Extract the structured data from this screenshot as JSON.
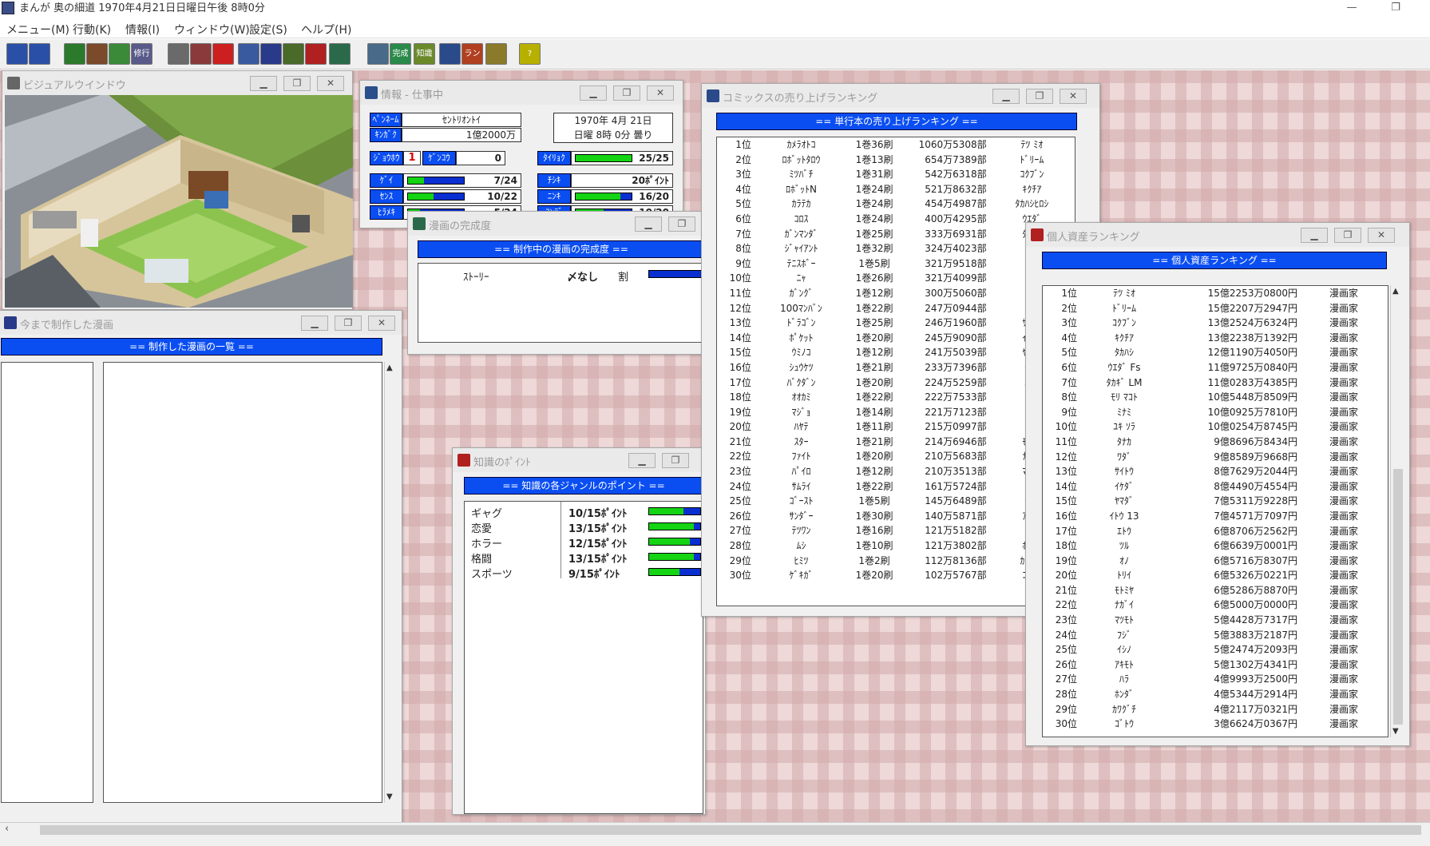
{
  "app": {
    "title": "まんが 奥の細道 1970年4月21日日曜日午後 8時0分",
    "min_icon": "—",
    "max_icon": "❐"
  },
  "menu": [
    "メニュー(M)",
    "行動(K)",
    "情報(I)",
    "ウィンドウ(W)",
    "設定(S)",
    "ヘルプ(H)"
  ],
  "toolbar": {
    "buttons": [
      {
        "name": "save-tool",
        "label": "",
        "color": "#2a4fa6"
      },
      {
        "name": "load-tool",
        "label": "",
        "color": "#2a4fa6"
      },
      {
        "name": "clock-tool",
        "label": "",
        "color": "#2b7a2b"
      },
      {
        "name": "work-tool",
        "label": "",
        "color": "#7a4a2a"
      },
      {
        "name": "people-tool",
        "label": "",
        "color": "#3a8a3a"
      },
      {
        "name": "travel-tool",
        "label": "修行",
        "color": "#5a5a8a"
      },
      {
        "name": "building-tool",
        "label": "",
        "color": "#6a6a6a"
      },
      {
        "name": "schedule-tool",
        "label": "",
        "color": "#8a3a3a"
      },
      {
        "name": "mailbox-tool",
        "label": "",
        "color": "#cc2020"
      },
      {
        "name": "person-tool",
        "label": "",
        "color": "#3a5aa0"
      },
      {
        "name": "assistant-tool",
        "label": "",
        "color": "#2a3a8a"
      },
      {
        "name": "staff-tool",
        "label": "",
        "color": "#4a6a2a"
      },
      {
        "name": "car-tool",
        "label": "",
        "color": "#b02020"
      },
      {
        "name": "book-tool",
        "label": "",
        "color": "#2a6a4a"
      },
      {
        "name": "info-tool",
        "label": "",
        "color": "#4a6a8a"
      },
      {
        "name": "completion-tool",
        "label": "完成",
        "color": "#2a8a4a"
      },
      {
        "name": "knowledge-tool",
        "label": "知識",
        "color": "#6a8a2a"
      },
      {
        "name": "comics-tool",
        "label": "",
        "color": "#2a4a8a"
      },
      {
        "name": "ranking-tool",
        "label": "ランキング",
        "color": "#b04020"
      },
      {
        "name": "trophy-tool",
        "label": "",
        "color": "#8a7a2a"
      },
      {
        "name": "help-tool",
        "label": "?",
        "color": "#b8b000"
      }
    ]
  },
  "windows": {
    "visual": {
      "title": "ビジュアルウインドウ"
    },
    "info": {
      "title": "情報 - 仕事中",
      "name_label": "ﾍﾟﾝﾈｰﾑ",
      "name_value": "ｾﾝﾄﾘｵﾝﾄｲ",
      "money_label": "ｷﾝｶﾞｸ",
      "money_value": "1億2000万",
      "date_line1": "1970年 4月 21日",
      "date_line2": "日曜 8時 0分 曇り",
      "s1_label": "ｼﾞｮｳﾎｳ",
      "s1_value": "1",
      "s2_label": "ｹﾞﾝｺｳ",
      "s2_value": "0",
      "s3_label": "ﾀｲﾘｮｸ",
      "s3_value": "25/25",
      "s3_ratio": 1.0,
      "stats": [
        {
          "label": "ｹﾞｲ",
          "value": "7/24",
          "ratio": 0.29
        },
        {
          "label": "ﾁｼｷ",
          "value": "20ﾎﾟｲﾝﾄ",
          "ratio": null
        },
        {
          "label": "ｾﾝｽ",
          "value": "10/22",
          "ratio": 0.45
        },
        {
          "label": "ﾆﾝｷ",
          "value": "16/20",
          "ratio": 0.8
        },
        {
          "label": "ﾋﾗﾒｷ",
          "value": "5/24",
          "ratio": 0.21
        },
        {
          "label": "ｺﾝﾃﾞ",
          "value": "10/20",
          "ratio": 0.5
        }
      ]
    },
    "completion": {
      "title": "漫画の完成度",
      "header": "== 制作中の漫画の完成度 ==",
      "item_label": "ｽﾄｰﾘｰ",
      "item_status": "〆なし",
      "item_unit": "割",
      "ratio": 1.0
    },
    "made": {
      "title": "今まで制作した漫画",
      "header": "== 制作した漫画の一覧 =="
    },
    "knowledge": {
      "title": "知識のﾎﾟｲﾝﾄ",
      "header": "== 知識の各ジャンルのポイント ==",
      "rows": [
        {
          "label": "ギャグ",
          "value": "10/15ﾎﾟｲﾝﾄ",
          "ratio": 0.67
        },
        {
          "label": "恋愛",
          "value": "13/15ﾎﾟｲﾝﾄ",
          "ratio": 0.87
        },
        {
          "label": "ホラー",
          "value": "12/15ﾎﾟｲﾝﾄ",
          "ratio": 0.8
        },
        {
          "label": "格闘",
          "value": "13/15ﾎﾟｲﾝﾄ",
          "ratio": 0.87
        },
        {
          "label": "スポーツ",
          "value": "9/15ﾎﾟｲﾝﾄ",
          "ratio": 0.6
        }
      ]
    },
    "comics": {
      "title": "コミックスの売り上げランキング",
      "header": "== 単行本の売り上げランキング ==",
      "rows": [
        [
          "1位",
          "ｶﾒﾗｵﾄｺ",
          "1巻36刷",
          "1060万5308部",
          "ﾃﾂ ﾐｵ"
        ],
        [
          "2位",
          "ﾛﾎﾞｯﾄﾀﾛｳ",
          "1巻13刷",
          "654万7389部",
          "ﾄﾞﾘｰﾑ"
        ],
        [
          "3位",
          "ﾐﾂﾊﾞﾁ",
          "1巻31刷",
          "542万6318部",
          "ｺｸﾌﾞﾝ"
        ],
        [
          "4位",
          "ﾛﾎﾞｯﾄN",
          "1巻24刷",
          "521万8632部",
          "ｷｸﾁｱ"
        ],
        [
          "5位",
          "ｶﾗﾃｶ",
          "1巻24刷",
          "454万4987部",
          "ﾀｶﾊｼﾋﾛｼ"
        ],
        [
          "6位",
          "ｺﾛｽ",
          "1巻24刷",
          "400万4295部",
          "ｳｴﾀﾞ"
        ],
        [
          "7位",
          "ｶﾞﾝﾏﾝﾀﾞ",
          "1巻25刷",
          "333万6931部",
          "ﾀｶｷﾞ"
        ],
        [
          "8位",
          "ｼﾞｬｲｱﾝﾄ",
          "1巻32刷",
          "324万4023部",
          "ﾓﾘ"
        ],
        [
          "9位",
          "ﾃﾆｽﾎﾞｰ",
          "1巻5刷",
          "321万9518部",
          "ﾐﾅﾐ"
        ],
        [
          "10位",
          "ﾆｬ",
          "1巻26刷",
          "321万4099部",
          "ﾕｷ"
        ],
        [
          "11位",
          "ｶﾞﾝｸﾞ",
          "1巻12刷",
          "300万5060部",
          "ﾀﾅｶ"
        ],
        [
          "12位",
          "100ﾏﾝﾊﾞﾝ",
          "1巻22刷",
          "247万0944部",
          "ﾜﾀﾞ"
        ],
        [
          "13位",
          "ﾄﾞﾗｺﾞﾝ",
          "1巻25刷",
          "246万1960部",
          "ｻｲﾄｳ"
        ],
        [
          "14位",
          "ﾎﾟｹｯﾄ",
          "1巻20刷",
          "245万9090部",
          "ｲｹﾀﾞ"
        ],
        [
          "15位",
          "ｳﾐﾉｺ",
          "1巻12刷",
          "241万5039部",
          "ﾔﾏﾀﾞ"
        ],
        [
          "16位",
          "ｼｭｳｹﾂ",
          "1巻21刷",
          "233万7396部",
          "ｲﾄｳ"
        ],
        [
          "17位",
          "ﾊﾞｸﾀﾞﾝ",
          "1巻20刷",
          "224万5259部",
          "ｴﾄｳ"
        ],
        [
          "18位",
          "ｵｵｶﾐ",
          "1巻22刷",
          "222万7533部",
          "ﾂﾙ"
        ],
        [
          "19位",
          "ﾏｼﾞｮ",
          "1巻14刷",
          "221万7123部",
          "ｵﾉ"
        ],
        [
          "20位",
          "ﾊﾔﾃ",
          "1巻11刷",
          "215万0997部",
          "ﾄﾘｲ"
        ],
        [
          "21位",
          "ｽﾀｰ",
          "1巻21刷",
          "214万6946部",
          "ﾓﾄﾐﾔ"
        ],
        [
          "22位",
          "ﾌｧｲﾄ",
          "1巻20刷",
          "210万5683部",
          "ﾅｶﾞｲ"
        ],
        [
          "23位",
          "ﾊﾟｲﾛ",
          "1巻12刷",
          "210万3513部",
          "ﾏﾂﾓﾄ"
        ],
        [
          "24位",
          "ｻﾑﾗｲ",
          "1巻22刷",
          "161万5724部",
          "ﾌｼﾞ"
        ],
        [
          "25位",
          "ｺﾞｰｽﾄ",
          "1巻5刷",
          "145万6489部",
          "ｲｼﾉ"
        ],
        [
          "26位",
          "ｻﾝﾀﾞｰ",
          "1巻30刷",
          "140万5871部",
          "ｱｷﾓﾄ"
        ],
        [
          "27位",
          "ﾃﾂﾜﾝ",
          "1巻16刷",
          "121万5182部",
          "ﾊﾗ"
        ],
        [
          "28位",
          "ﾑｼ",
          "1巻10刷",
          "121万3802部",
          "ﾎﾝﾀﾞ"
        ],
        [
          "29位",
          "ﾋﾐﾂ",
          "1巻2刷",
          "112万8136部",
          "ｶﾜｸﾞﾁ"
        ],
        [
          "30位",
          "ｹﾞｷｶﾞ",
          "1巻20刷",
          "102万5767部",
          "ｺﾞﾄｳ"
        ]
      ]
    },
    "assets": {
      "title": "個人資産ランキング",
      "header": "== 個人資産ランキング ==",
      "rows": [
        [
          "1位",
          "ﾃﾂ ﾐｵ",
          "15億2253万0800円",
          "漫画家"
        ],
        [
          "2位",
          "ﾄﾞﾘｰﾑ",
          "15億2207万2947円",
          "漫画家"
        ],
        [
          "3位",
          "ｺｸﾌﾞﾝ",
          "13億2524万6324円",
          "漫画家"
        ],
        [
          "4位",
          "ｷｸﾁｱ",
          "13億2238万1392円",
          "漫画家"
        ],
        [
          "5位",
          "ﾀｶﾊｼ",
          "12億1190万4050円",
          "漫画家"
        ],
        [
          "6位",
          "ｳｴﾀﾞ Fs",
          "11億9725万0840円",
          "漫画家"
        ],
        [
          "7位",
          "ﾀｶｷﾞ LM",
          "11億0283万4385円",
          "漫画家"
        ],
        [
          "8位",
          "ﾓﾘ ﾏｺﾄ",
          "10億5448万8509円",
          "漫画家"
        ],
        [
          "9位",
          "ﾐﾅﾐ",
          "10億0925万7810円",
          "漫画家"
        ],
        [
          "10位",
          "ﾕｷ ｿﾗ",
          "10億0254万8745円",
          "漫画家"
        ],
        [
          "11位",
          "ﾀﾅｶ",
          "9億8696万8434円",
          "漫画家"
        ],
        [
          "12位",
          "ﾜﾀﾞ",
          "9億8589万9668円",
          "漫画家"
        ],
        [
          "13位",
          "ｻｲﾄｳ",
          "8億7629万2044円",
          "漫画家"
        ],
        [
          "14位",
          "ｲｹﾀﾞ",
          "8億4490万4554円",
          "漫画家"
        ],
        [
          "15位",
          "ﾔﾏﾀﾞ",
          "7億5311万9228円",
          "漫画家"
        ],
        [
          "16位",
          "ｲﾄｳ 13",
          "7億4571万7097円",
          "漫画家"
        ],
        [
          "17位",
          "ｴﾄｳ",
          "6億8706万2562円",
          "漫画家"
        ],
        [
          "18位",
          "ﾂﾙ",
          "6億6639万0001円",
          "漫画家"
        ],
        [
          "19位",
          "ｵﾉ",
          "6億5716万8307円",
          "漫画家"
        ],
        [
          "20位",
          "ﾄﾘｲ",
          "6億5326万0221円",
          "漫画家"
        ],
        [
          "21位",
          "ﾓﾄﾐﾔ",
          "6億5286万8870円",
          "漫画家"
        ],
        [
          "22位",
          "ﾅｶﾞｲ",
          "6億5000万0000円",
          "漫画家"
        ],
        [
          "23位",
          "ﾏﾂﾓﾄ",
          "5億4428万7317円",
          "漫画家"
        ],
        [
          "24位",
          "ﾌｼﾞ",
          "5億3883万2187円",
          "漫画家"
        ],
        [
          "25位",
          "ｲｼﾉ",
          "5億2474万2093円",
          "漫画家"
        ],
        [
          "26位",
          "ｱｷﾓﾄ",
          "5億1302万4341円",
          "漫画家"
        ],
        [
          "27位",
          "ﾊﾗ",
          "4億9993万2500円",
          "漫画家"
        ],
        [
          "28位",
          "ﾎﾝﾀﾞ",
          "4億5344万2914円",
          "漫画家"
        ],
        [
          "29位",
          "ｶﾜｸﾞﾁ",
          "4億2117万0321円",
          "漫画家"
        ],
        [
          "30位",
          "ｺﾞﾄｳ",
          "3億6624万0367円",
          "漫画家"
        ]
      ]
    }
  }
}
